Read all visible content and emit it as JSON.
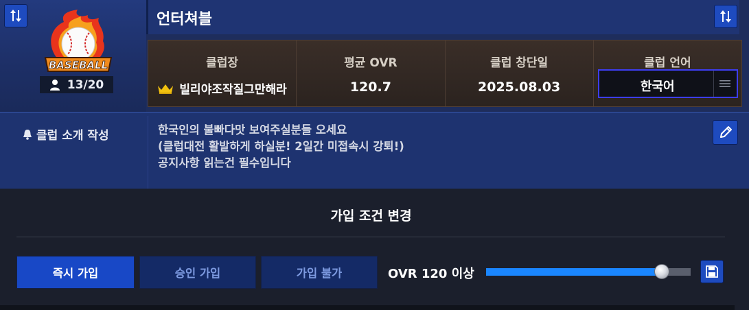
{
  "club": {
    "name": "언터쳐블",
    "emblem_text": "BASEBALL",
    "member_count": "13/20"
  },
  "info": {
    "leader_label": "클럽장",
    "leader_value": "빌리야조작질그만해라",
    "avg_ovr_label": "평균 OVR",
    "avg_ovr_value": "120.7",
    "founded_label": "클럽 창단일",
    "founded_value": "2025.08.03",
    "language_label": "클럽 언어",
    "language_value": "한국어"
  },
  "intro": {
    "label": "클럽 소개 작성",
    "text": "한국인의 불빠다맛 보여주실분들 오세요\n(클럽대전 활발하게 하실분! 2일간 미접속시 강퇴!)\n공지사항 읽는건 필수입니다"
  },
  "join": {
    "title": "가입 조건 변경",
    "buttons": [
      "즉시 가입",
      "승인 가입",
      "가입 불가"
    ],
    "selected": "즉시 가입",
    "ovr_condition": "OVR 120 이상",
    "slider_fraction": 0.86
  },
  "icons": {
    "swap": "swap-arrows-icon",
    "edit": "pencil-icon",
    "save": "floppy-disk-icon",
    "member": "person-icon",
    "crown": "crown-icon",
    "bell": "bell-icon",
    "menu": "hamburger-icon"
  },
  "colors": {
    "accent_blue": "#1848c6",
    "slider_fill": "#1a86ff",
    "crown_gold": "#f2c10f"
  }
}
